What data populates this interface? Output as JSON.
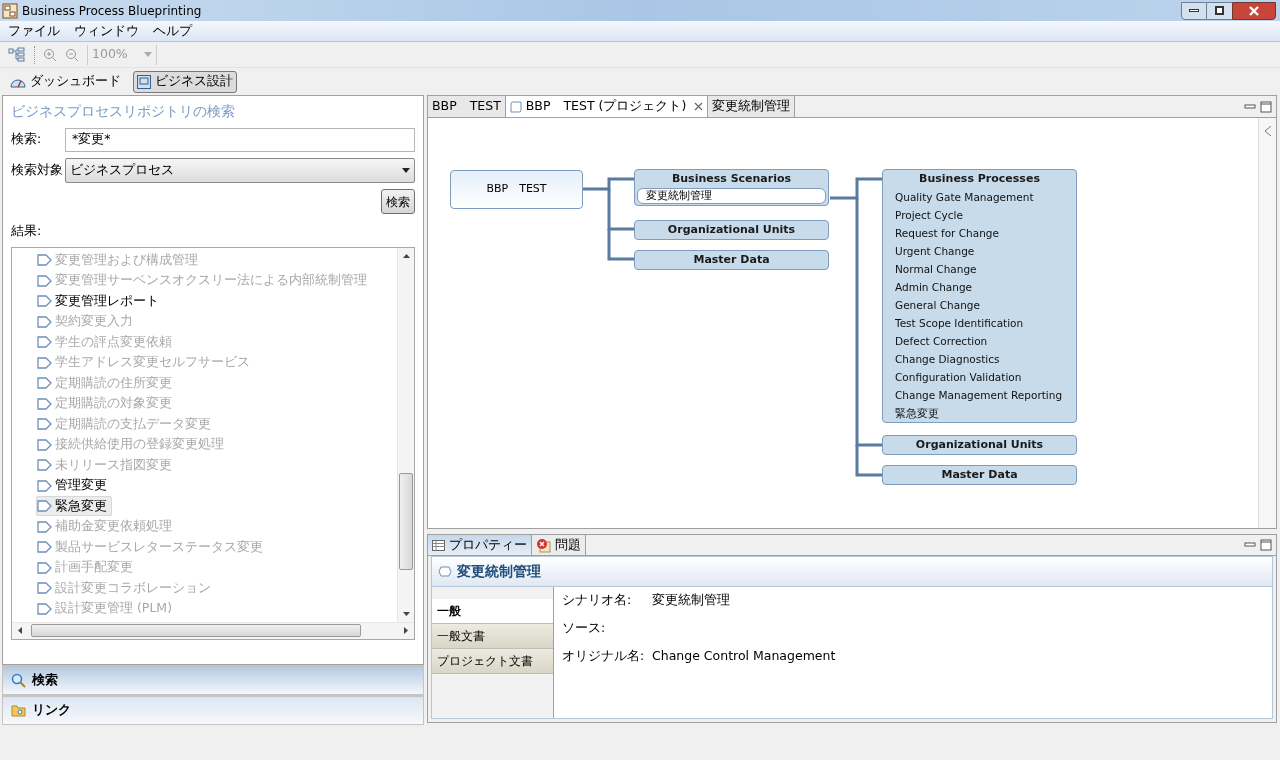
{
  "window": {
    "title": "Business Process Blueprinting"
  },
  "menu": [
    "ファイル",
    "ウィンドウ",
    "ヘルプ"
  ],
  "toolbar": {
    "zoom": "100%"
  },
  "perspectives": [
    {
      "label": "ダッシュボード",
      "selected": false
    },
    {
      "label": "ビジネス設計",
      "selected": true
    }
  ],
  "search_panel": {
    "title": "ビジネスプロセスリポジトリの検索",
    "search_label": "検索:",
    "search_value": "*変更*",
    "target_label": "検索対象",
    "target_value": "ビジネスプロセス",
    "search_button": "検索",
    "results_label": "結果:",
    "results": [
      {
        "label": "変更管理および構成管理",
        "enabled": false,
        "selected": false
      },
      {
        "label": "変更管理サーベンスオクスリー法による内部統制管理",
        "enabled": false,
        "selected": false
      },
      {
        "label": "変更管理レポート",
        "enabled": true,
        "selected": false
      },
      {
        "label": "契約変更入力",
        "enabled": false,
        "selected": false
      },
      {
        "label": "学生の評点変更依頼",
        "enabled": false,
        "selected": false
      },
      {
        "label": "学生アドレス変更セルフサービス",
        "enabled": false,
        "selected": false
      },
      {
        "label": "定期購読の住所変更",
        "enabled": false,
        "selected": false
      },
      {
        "label": "定期購読の対象変更",
        "enabled": false,
        "selected": false
      },
      {
        "label": "定期購読の支払データ変更",
        "enabled": false,
        "selected": false
      },
      {
        "label": "接続供給使用の登録変更処理",
        "enabled": false,
        "selected": false
      },
      {
        "label": "未リリース指図変更",
        "enabled": false,
        "selected": false
      },
      {
        "label": "管理変更",
        "enabled": true,
        "selected": false
      },
      {
        "label": "緊急変更",
        "enabled": true,
        "selected": true
      },
      {
        "label": "補助金変更依頼処理",
        "enabled": false,
        "selected": false
      },
      {
        "label": "製品サービスレターステータス変更",
        "enabled": false,
        "selected": false
      },
      {
        "label": "計画手配変更",
        "enabled": false,
        "selected": false
      },
      {
        "label": "設計変更コラボレーション",
        "enabled": false,
        "selected": false
      },
      {
        "label": "設計変更管理 (PLM)",
        "enabled": false,
        "selected": false
      }
    ]
  },
  "accordion": [
    {
      "label": "検索",
      "kind": "search",
      "selected": true
    },
    {
      "label": "リンク",
      "kind": "link",
      "selected": false
    }
  ],
  "editor_tabs": [
    {
      "label": "BBP　TEST",
      "selected": false,
      "closable": false
    },
    {
      "label": "BBP　TEST (プロジェクト)",
      "selected": true,
      "closable": true
    },
    {
      "label": "変更統制管理",
      "selected": false,
      "closable": false
    }
  ],
  "diagram": {
    "root": "BBP　TEST",
    "level1": [
      {
        "title": "Business Scenarios",
        "items": [
          {
            "label": "変更統制管理",
            "selected": true
          }
        ]
      },
      {
        "title": "Organizational Units"
      },
      {
        "title": "Master Data"
      }
    ],
    "level2": [
      {
        "title": "Business Processes",
        "items": [
          {
            "label": "Quality Gate Management",
            "selected": false
          },
          {
            "label": "Project Cycle",
            "selected": false
          },
          {
            "label": "Request for Change",
            "selected": false
          },
          {
            "label": "Urgent Change",
            "selected": false
          },
          {
            "label": "Normal Change",
            "selected": false
          },
          {
            "label": "Admin Change",
            "selected": false
          },
          {
            "label": "General Change",
            "selected": false
          },
          {
            "label": "Test Scope Identification",
            "selected": false
          },
          {
            "label": "Defect Correction",
            "selected": false
          },
          {
            "label": "Change Diagnostics",
            "selected": false
          },
          {
            "label": "Configuration Validation",
            "selected": false
          },
          {
            "label": "Change Management Reporting",
            "selected": false
          },
          {
            "label": "緊急変更",
            "selected": false
          }
        ]
      },
      {
        "title": "Organizational Units"
      },
      {
        "title": "Master Data"
      }
    ]
  },
  "bottom_tabs": [
    {
      "label": "プロパティー",
      "kind": "properties",
      "selected": true
    },
    {
      "label": "問題",
      "kind": "problems",
      "selected": false
    }
  ],
  "properties": {
    "title": "変更統制管理",
    "sections": [
      {
        "label": "一般",
        "selected": true
      },
      {
        "label": "一般文書",
        "selected": false
      },
      {
        "label": "プロジェクト文書",
        "selected": false
      }
    ],
    "fields": [
      {
        "label": "シナリオ名:",
        "value": "変更統制管理"
      },
      {
        "label": "ソース:"
      },
      {
        "label": "オリジナル名:",
        "value": "Change Control Management"
      }
    ]
  }
}
